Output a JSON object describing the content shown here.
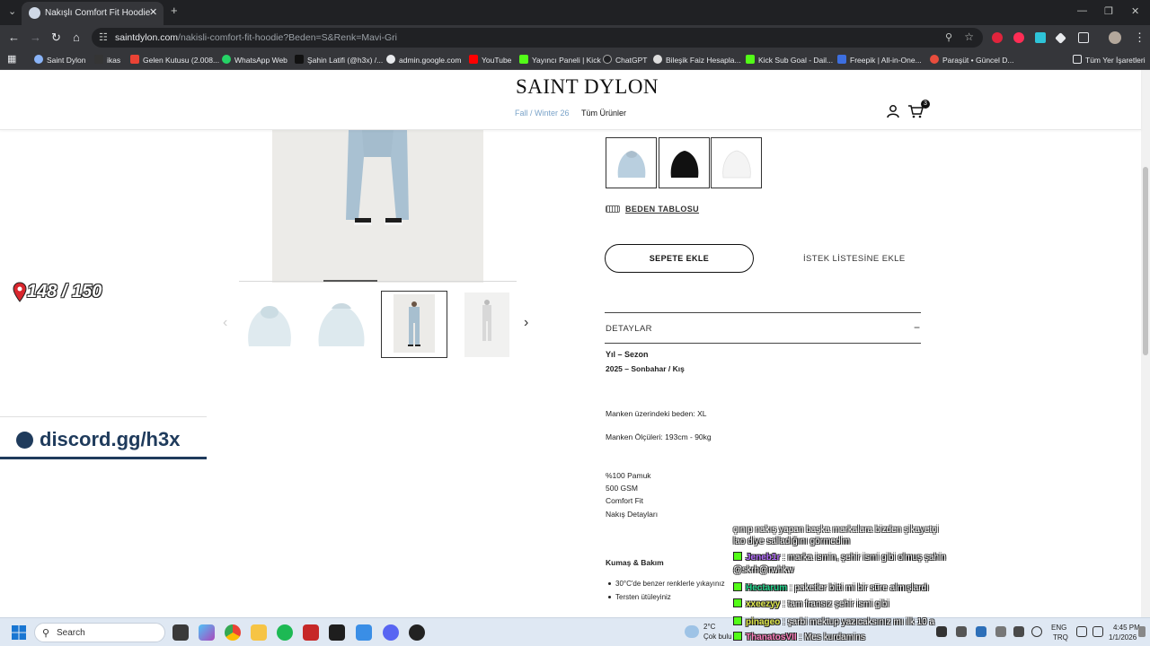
{
  "browser": {
    "tab_title": "Nakışlı Comfort Fit Hoodie",
    "url_domain": "saintdylon.com",
    "url_path": "/nakisli-comfort-fit-hoodie?Beden=S&Renk=Mavi-Gri",
    "bookmarks": [
      "Saint Dylon",
      "ikas",
      "Gelen Kutusu (2.008...",
      "WhatsApp Web",
      "Şahin Latifi (@h3x) /...",
      "admin.google.com",
      "YouTube",
      "Yayıncı Paneli | Kick",
      "ChatGPT",
      "Bileşik Faiz Hesapla...",
      "Kick Sub Goal - Dail...",
      "Freepik | All-in-One...",
      "Paraşüt • Güncel D..."
    ],
    "all_bookmarks": "Tüm Yer İşaretleri"
  },
  "site": {
    "logo": "SAINT DYLON",
    "nav_collection": "Fall / Winter 26",
    "nav_all": "Tüm Ürünler",
    "cart_count": "3",
    "size_chart": "BEDEN TABLOSU",
    "add_to_cart": "SEPETE EKLE",
    "wishlist": "İSTEK LİSTESİNE EKLE",
    "details_title": "DETAYLAR",
    "details_toggle": "−",
    "year_label": "Yıl – Sezon",
    "year_value": "2025 – Sonbahar / Kış",
    "model_size": "Manken üzerindeki beden: XL",
    "model_measure": "Manken Ölçüleri: 193cm - 90kg",
    "material": [
      "%100 Pamuk",
      "500 GSM",
      "Comfort Fit",
      "Nakış Detayları"
    ],
    "care_title": "Kumaş & Bakım",
    "care": [
      "30°C'de benzer renklerle yıkayınız",
      "Tersten ütüleyiniz"
    ],
    "image_progress": 0.25,
    "swatch_colors": [
      "#b9cfdf",
      "#111111",
      "#f4f4f4"
    ]
  },
  "overlay": {
    "counter": "148 / 150",
    "discord": "discord.gg/h3x",
    "chat": [
      {
        "user": "",
        "text": "çınıp nakış yapan başka markalara bizden şikayetçi"
      },
      {
        "user": "",
        "text": "lao diye salladığını görmedim"
      },
      {
        "user": "Jeneb1r",
        "text": ": marka ismin, şehir ismi gibi olmuş şahin"
      },
      {
        "user": "",
        "text": "@skrh@rwhkw"
      },
      {
        "user": "Hectarum",
        "text": ": paketler bitti mi bir süre almışlardı"
      },
      {
        "user": "xxeezyy",
        "text": ": tam fransız şehir ismi gibi"
      },
      {
        "user": "pinageo",
        "text": ": şarbi mektup yazıcaksınız mı ilk 10 a"
      },
      {
        "user": "ThanatosVII",
        "text": ": Mes kurdamins"
      }
    ]
  },
  "taskbar": {
    "search_placeholder": "Search",
    "weather_temp": "2°C",
    "weather_desc": "Çok bulu",
    "lang1": "ENG",
    "lang2": "TRQ",
    "time": "4:45 PM",
    "date": "1/1/2026"
  }
}
